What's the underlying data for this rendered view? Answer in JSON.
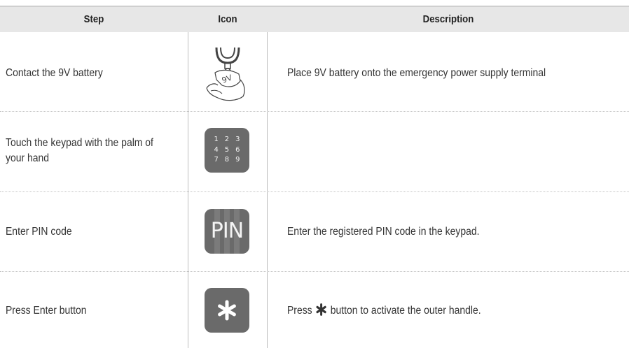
{
  "table": {
    "headers": {
      "step": "Step",
      "icon": "Icon",
      "description": "Description"
    },
    "rows": [
      {
        "step": "Contact the 9V battery",
        "icon": "battery-contact-icon",
        "description": "Place 9V battery onto the emergency power supply terminal"
      },
      {
        "step": "Touch the keypad with the palm of your hand",
        "icon": "keypad-icon",
        "keypad_keys": [
          "1",
          "2",
          "3",
          "4",
          "5",
          "6",
          "7",
          "8",
          "9"
        ],
        "description": ""
      },
      {
        "step": "Enter PIN code",
        "icon": "pin-icon",
        "icon_text": "PIN",
        "description": "Enter the registered PIN code in the keypad."
      },
      {
        "step": "Press Enter button",
        "icon": "enter-asterisk-icon",
        "description_before": "Press",
        "description_after": "button to activate the outer handle."
      }
    ]
  },
  "colors": {
    "header_bg": "#e7e7e7",
    "icon_tile": "#6a6a6a",
    "text": "#333333",
    "separator": "#c4c4c4"
  }
}
